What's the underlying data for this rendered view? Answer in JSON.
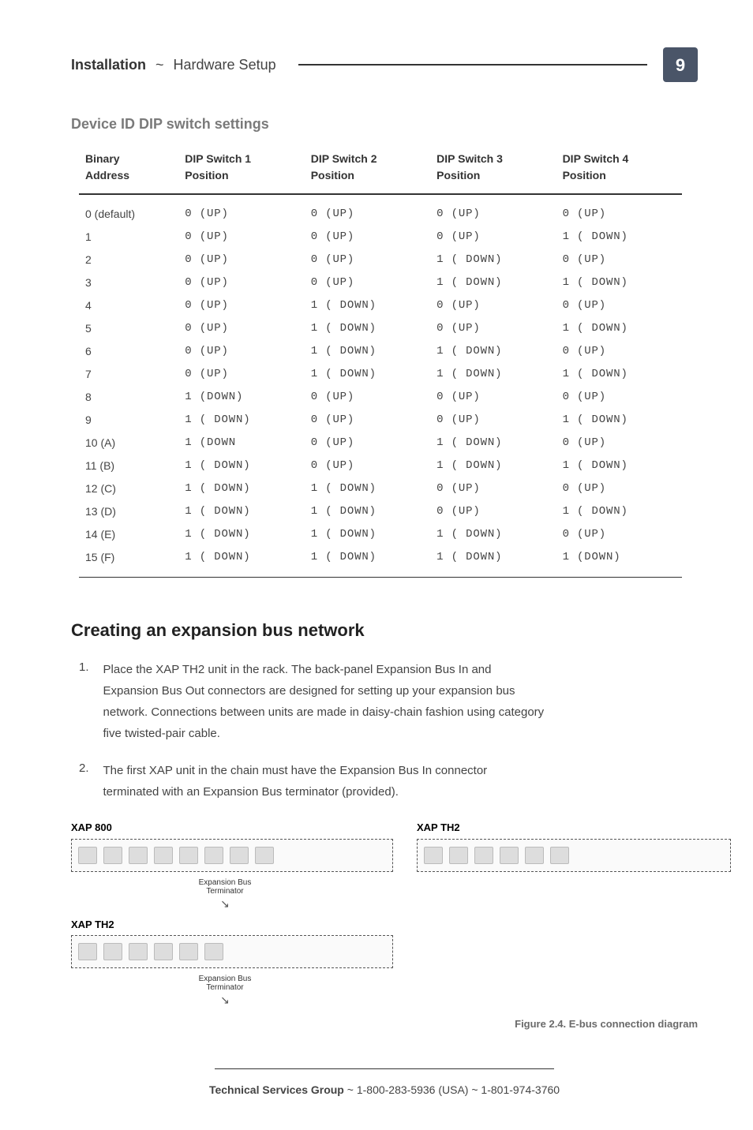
{
  "header": {
    "section": "Installation",
    "separator": "~",
    "subsection": "Hardware Setup",
    "page_number": "9"
  },
  "dip_section": {
    "title": "Device ID DIP switch settings",
    "columns": [
      {
        "l1": "Binary",
        "l2": "Address"
      },
      {
        "l1": "DIP Switch 1",
        "l2": "Position"
      },
      {
        "l1": "DIP Switch 2",
        "l2": "Position"
      },
      {
        "l1": "DIP Switch 3",
        "l2": "Position"
      },
      {
        "l1": "DIP Switch 4",
        "l2": "Position"
      }
    ],
    "rows": [
      {
        "addr": "0 (default)",
        "s1": "0 (UP)",
        "s2": "0 (UP)",
        "s3": "0 (UP)",
        "s4": "0 (UP)"
      },
      {
        "addr": "1",
        "s1": "0 (UP)",
        "s2": "0 (UP)",
        "s3": "0 (UP)",
        "s4": "1 ( DOWN)"
      },
      {
        "addr": "2",
        "s1": "0 (UP)",
        "s2": "0 (UP)",
        "s3": "1 ( DOWN)",
        "s4": "0 (UP)"
      },
      {
        "addr": "3",
        "s1": "0 (UP)",
        "s2": "0 (UP)",
        "s3": "1 ( DOWN)",
        "s4": "1 ( DOWN)"
      },
      {
        "addr": "4",
        "s1": "0 (UP)",
        "s2": "1 ( DOWN)",
        "s3": "0 (UP)",
        "s4": "0 (UP)"
      },
      {
        "addr": "5",
        "s1": "0 (UP)",
        "s2": "1 ( DOWN)",
        "s3": "0 (UP)",
        "s4": "1 ( DOWN)"
      },
      {
        "addr": "6",
        "s1": "0 (UP)",
        "s2": "1 ( DOWN)",
        "s3": "1 ( DOWN)",
        "s4": "0 (UP)"
      },
      {
        "addr": "7",
        "s1": "0 (UP)",
        "s2": "1 ( DOWN)",
        "s3": "1 ( DOWN)",
        "s4": "1 ( DOWN)"
      },
      {
        "addr": "8",
        "s1": "1 (DOWN)",
        "s2": "0 (UP)",
        "s3": "0 (UP)",
        "s4": "0 (UP)"
      },
      {
        "addr": "9",
        "s1": "1 ( DOWN)",
        "s2": "0 (UP)",
        "s3": "0 (UP)",
        "s4": "1 ( DOWN)"
      },
      {
        "addr": "10 (A)",
        "s1": "1 (DOWN",
        "s2": "0 (UP)",
        "s3": "1 ( DOWN)",
        "s4": "0 (UP)"
      },
      {
        "addr": "11 (B)",
        "s1": "1 ( DOWN)",
        "s2": "0 (UP)",
        "s3": "1 ( DOWN)",
        "s4": "1 ( DOWN)"
      },
      {
        "addr": "12 (C)",
        "s1": "1 ( DOWN)",
        "s2": "1 ( DOWN)",
        "s3": "0 (UP)",
        "s4": "0 (UP)"
      },
      {
        "addr": "13 (D)",
        "s1": "1 ( DOWN)",
        "s2": "1 ( DOWN)",
        "s3": "0 (UP)",
        "s4": "1 ( DOWN)"
      },
      {
        "addr": "14 (E)",
        "s1": "1 ( DOWN)",
        "s2": "1 ( DOWN)",
        "s3": "1 ( DOWN)",
        "s4": "0 (UP)"
      },
      {
        "addr": "15 (F)",
        "s1": "1 ( DOWN)",
        "s2": "1 ( DOWN)",
        "s3": "1 ( DOWN)",
        "s4": "1 (DOWN)"
      }
    ]
  },
  "ebus_section": {
    "title": "Creating an expansion bus network",
    "steps": [
      {
        "num": "1.",
        "text": "Place the XAP TH2 unit in the rack. The back-panel Expansion Bus In and Expansion Bus Out connectors are designed for setting up your expansion bus network. Connections between units are made in daisy-chain fashion using category five twisted-pair cable."
      },
      {
        "num": "2.",
        "text": "The first XAP unit in the chain must have the Expansion Bus In connector terminated with an Expansion Bus terminator (provided)."
      }
    ]
  },
  "figure": {
    "label_xap800": "XAP 800",
    "label_xapth2": "XAP TH2",
    "terminator_label": "Expansion Bus\nTerminator",
    "caption": "Figure 2.4. E-bus connection diagram"
  },
  "footer": {
    "group": "Technical Services Group",
    "sep": " ~ ",
    "phones": "1-800-283-5936 (USA) ~ 1-801-974-3760"
  }
}
